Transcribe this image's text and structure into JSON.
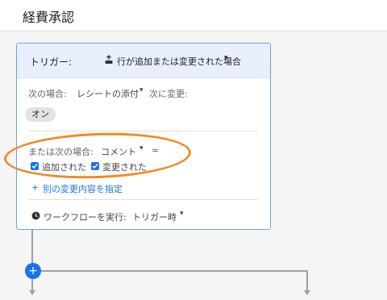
{
  "header": {
    "title": "経費承認"
  },
  "trigger": {
    "label": "トリガー:",
    "icon": "person-add-icon",
    "value": "行が追加または変更された場合",
    "caret": "▾"
  },
  "condition1": {
    "prefix": "次の場合:",
    "column": "レシートの添付",
    "caret": "▾",
    "change_label": "次に変更:",
    "chip": "オン"
  },
  "condition2": {
    "prefix": "または次の場合:",
    "column": "コメント",
    "caret": "▾",
    "equals": "=",
    "checkbox1": "追加された",
    "checkbox2": "変更された",
    "add_link": "別の変更内容を指定",
    "add_icon": "+"
  },
  "run": {
    "label": "ワークフローを実行:",
    "value": "トリガー時",
    "caret": "▾"
  },
  "add_step": "+",
  "colors": {
    "accent": "#1a73e8",
    "highlight": "#f08a24",
    "card_head": "#e8f0fd"
  }
}
